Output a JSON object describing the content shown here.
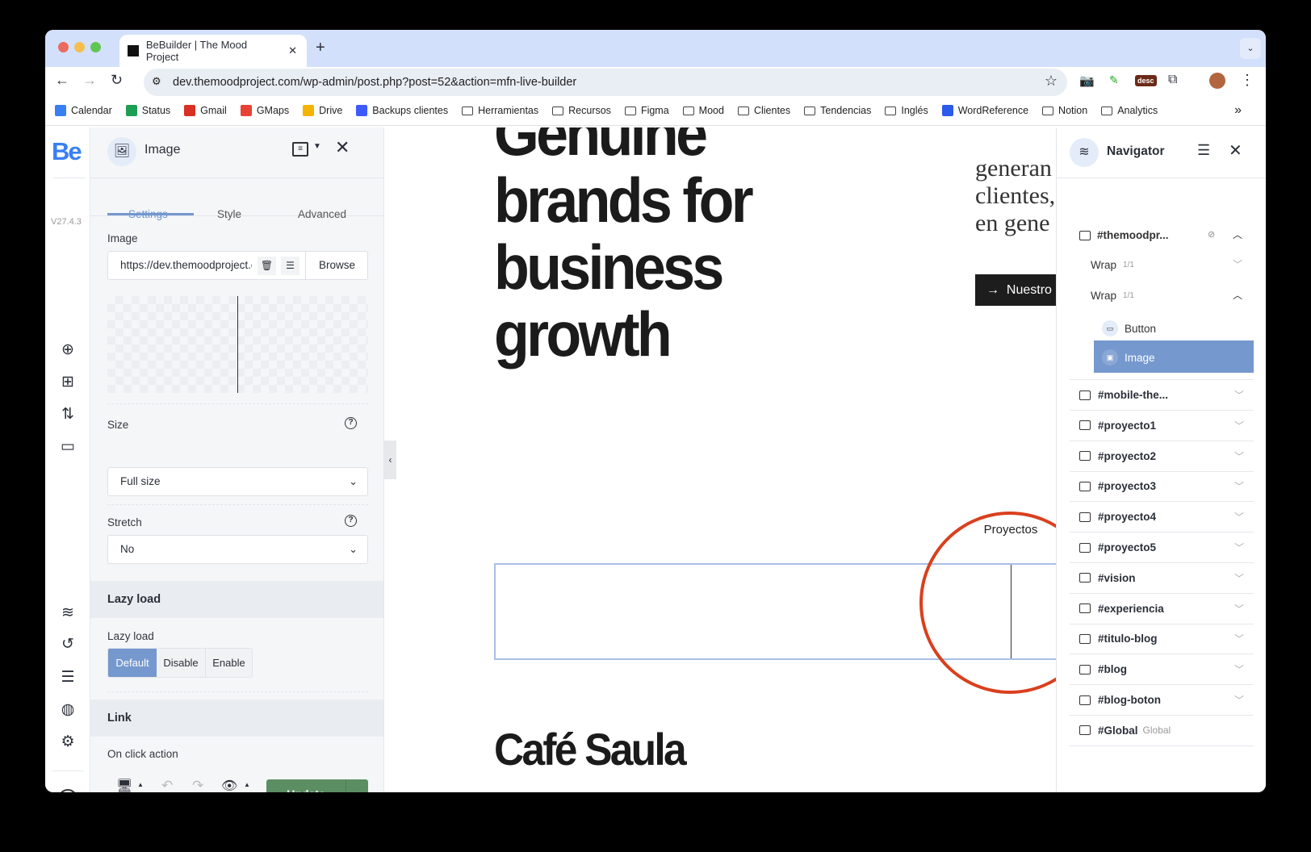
{
  "browser": {
    "tab_title": "BeBuilder | The Mood Project",
    "new_tab": "+",
    "url": "dev.themoodproject.com/wp-admin/post.php?post=52&action=mfn-live-builder",
    "ext_badge": "desc",
    "more": "⋮"
  },
  "bookmarks": [
    {
      "label": "Calendar",
      "icon": "calendar-icon"
    },
    {
      "label": "Status",
      "icon": "meet-icon"
    },
    {
      "label": "Gmail",
      "icon": "gmail-icon"
    },
    {
      "label": "GMaps",
      "icon": "maps-pin-icon"
    },
    {
      "label": "Drive",
      "icon": "drive-icon"
    },
    {
      "label": "Backups clientes",
      "icon": "dropbox-icon"
    },
    {
      "label": "Herramientas",
      "icon": "folder-icon"
    },
    {
      "label": "Recursos",
      "icon": "folder-icon"
    },
    {
      "label": "Figma",
      "icon": "folder-icon"
    },
    {
      "label": "Mood",
      "icon": "folder-icon"
    },
    {
      "label": "Clientes",
      "icon": "folder-icon"
    },
    {
      "label": "Tendencias",
      "icon": "folder-icon"
    },
    {
      "label": "Inglés",
      "icon": "folder-icon"
    },
    {
      "label": "WordReference",
      "icon": "wordreference-icon"
    },
    {
      "label": "Notion",
      "icon": "folder-icon"
    },
    {
      "label": "Analytics",
      "icon": "folder-icon"
    }
  ],
  "bookmarks_overflow": "»",
  "rail": {
    "logo": "Be",
    "version": "V27.4.3"
  },
  "panel": {
    "title": "Image",
    "tabs": [
      "Settings",
      "Style",
      "Advanced"
    ],
    "active_tab": "Settings",
    "image_label": "Image",
    "image_url": "https://dev.themoodproject.com",
    "browse": "Browse",
    "size_label": "Size",
    "size_value": "Full size",
    "stretch_label": "Stretch",
    "stretch_value": "No",
    "lazy_section": "Lazy load",
    "lazy_label": "Lazy load",
    "lazy_options": [
      "Default",
      "Disable",
      "Enable"
    ],
    "lazy_selected": "Default",
    "link_section": "Link",
    "onclick_label": "On click action",
    "update": "Update",
    "accent": "#7598ce",
    "update_color": "#5c8e63"
  },
  "canvas": {
    "headline": [
      "Genuine",
      "brands for",
      "business",
      "growth"
    ],
    "side_text": [
      "generan",
      "clientes,",
      "en gene"
    ],
    "cta": "Nuestro",
    "proyectos": "Proyectos",
    "cafe": "Café Saula",
    "highlight_color": "#d9401e"
  },
  "navigator": {
    "title": "Navigator",
    "root": "#themoodpr...",
    "wraps": [
      {
        "label": "Wrap",
        "count": "1/1"
      },
      {
        "label": "Wrap",
        "count": "1/1"
      }
    ],
    "children": [
      "Button",
      "Image"
    ],
    "selected": "Image",
    "sections": [
      "#mobile-the...",
      "#proyecto1",
      "#proyecto2",
      "#proyecto3",
      "#proyecto4",
      "#proyecto5",
      "#vision",
      "#experiencia",
      "#titulo-blog",
      "#blog",
      "#blog-boton",
      "#Global"
    ],
    "global_tag": "Global"
  }
}
